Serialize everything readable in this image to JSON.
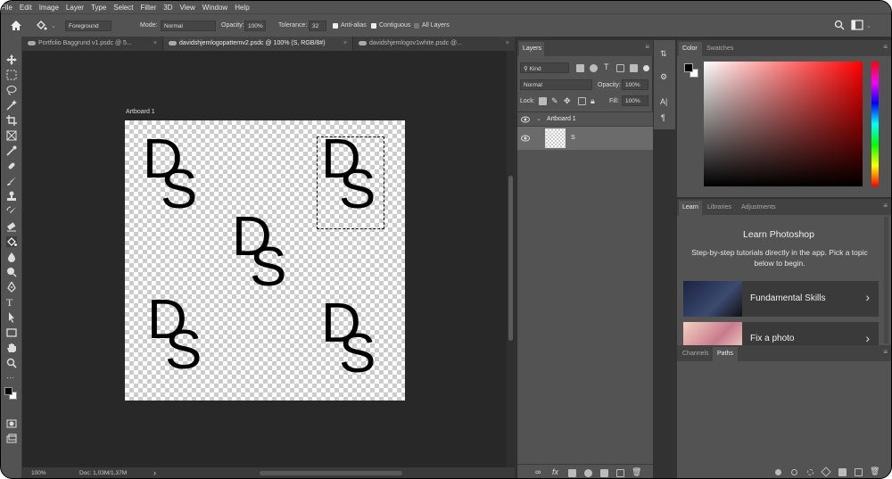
{
  "menubar": {
    "items": [
      "File",
      "Edit",
      "Image",
      "Layer",
      "Type",
      "Select",
      "Filter",
      "3D",
      "View",
      "Window",
      "Help"
    ]
  },
  "options_bar": {
    "fill_source": "Foreground",
    "mode_label": "Mode:",
    "mode_value": "Normal",
    "opacity_label": "Opacity:",
    "opacity_value": "100%",
    "tolerance_label": "Tolerance:",
    "tolerance_value": "32",
    "anti_alias_label": "Anti-alias",
    "contiguous_label": "Contiguous",
    "all_layers_label": "All Layers",
    "anti_alias_checked": true,
    "contiguous_checked": true,
    "all_layers_checked": false
  },
  "tabs": [
    {
      "label": "Portfolio Baggrund v1.psdc @ 5...",
      "active": false
    },
    {
      "label": "davidshjemlogopatternv2.psdc @ 100% (S, RGB/8#)",
      "active": true
    },
    {
      "label": "davidshjemlogov1white.psdc @...",
      "active": false
    }
  ],
  "canvas": {
    "artboard_name": "Artboard 1",
    "logo_letters": {
      "d": "D",
      "s": "S"
    }
  },
  "status": {
    "zoom": "100%",
    "doc": "Doc: 1,03M/1,37M",
    "arrow": "›"
  },
  "layers_panel": {
    "title": "Layers",
    "filter_kind": "Kind",
    "blend_mode": "Normal",
    "opacity_label": "Opacity:",
    "opacity_value": "100%",
    "lock_label": "Lock:",
    "fill_label": "Fill:",
    "fill_value": "100%",
    "artboard_layer": "Artboard 1",
    "child_layer": "S"
  },
  "color_panel": {
    "tabs": [
      "Color",
      "Swatches"
    ],
    "foreground": "#000000",
    "background": "#ffffff"
  },
  "learn_panel": {
    "tabs": [
      "Learn",
      "Libraries",
      "Adjustments"
    ],
    "heading": "Learn Photoshop",
    "description": "Step-by-step tutorials directly in the app. Pick a topic below to begin.",
    "cards": [
      {
        "label": "Fundamental Skills",
        "chevron": "›"
      },
      {
        "label": "Fix a photo",
        "chevron": "›"
      }
    ]
  },
  "paths_panel": {
    "tabs": [
      "Channels",
      "Paths"
    ]
  },
  "mid_strip": {
    "text_tool": "A|",
    "paragraph": "¶"
  }
}
